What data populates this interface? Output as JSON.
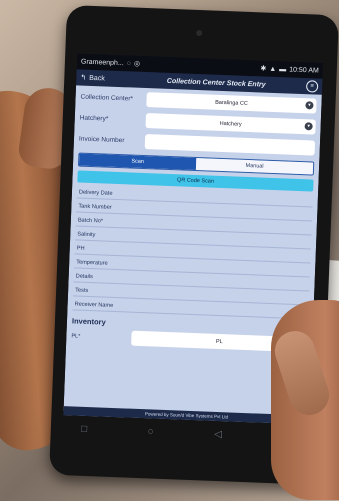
{
  "statusbar": {
    "carrier": "Grameenph...",
    "time": "10:50 AM",
    "icons": [
      "chat-icon",
      "location-icon",
      "bluetooth-icon",
      "signal-icon",
      "battery-icon"
    ]
  },
  "titlebar": {
    "back_label": "Back",
    "title": "Collection Center Stock Entry"
  },
  "form": {
    "collection_center_label": "Collection Center*",
    "collection_center_value": "Baralinga CC",
    "hatchery_label": "Hatchery*",
    "hatchery_value": "Hatchery",
    "invoice_label": "Invoice Number",
    "invoice_value": ""
  },
  "mode_toggle": {
    "scan_label": "Scan",
    "manual_label": "Manual"
  },
  "qr_button_label": "QR Code Scan",
  "fields": [
    "Delivery Date",
    "Tank Number",
    "Batch No*",
    "Salinity",
    "PH",
    "Temperature",
    "Details",
    "Tests",
    "Receiver Name"
  ],
  "inventory": {
    "section_title": "Inventory",
    "row_label": "PL*",
    "row_value": "PL"
  },
  "footer_text": "Powered by Soun/d Vibe Systems Pvt Ltd",
  "navbar": [
    "□",
    "○",
    "◁",
    "⋮"
  ]
}
